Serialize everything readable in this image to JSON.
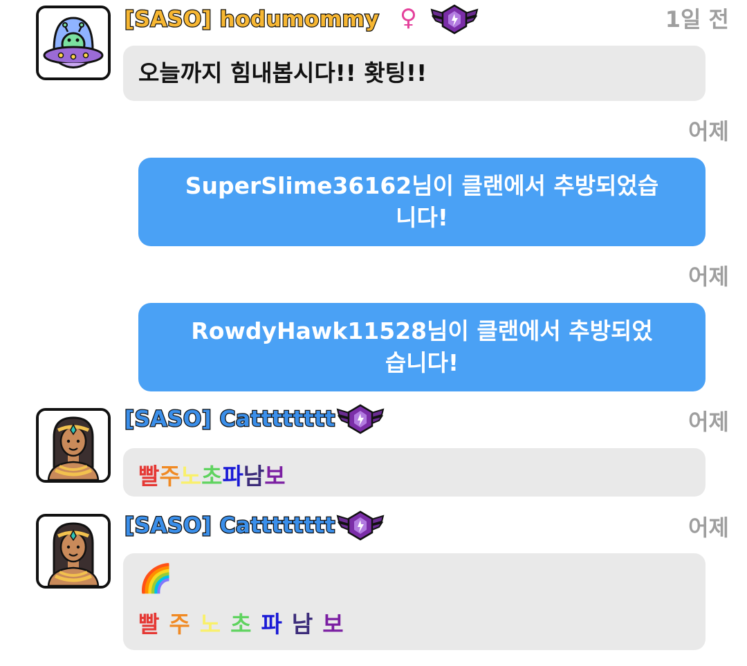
{
  "messages": [
    {
      "username": "[SASO] hodumommy",
      "gender_icon": "♀",
      "badge": "clan-rank-badge-icon",
      "time": "1일 전",
      "text": "오늘까지 힘내봅시다!! 홧팅!!"
    },
    {
      "time": "어제",
      "system_line1": "SuperSlime36162님이 클랜에서 추방되었습",
      "system_line2": "니다!"
    },
    {
      "time": "어제",
      "system_line1": "RowdyHawk11528님이 클랜에서 추방되었",
      "system_line2": "습니다!"
    },
    {
      "username": "[SASO] Catttttttt",
      "badge": "clan-rank-badge-icon",
      "time": "어제",
      "rainbow": [
        "빨",
        "주",
        "노",
        "초",
        "파",
        "남",
        "보"
      ]
    },
    {
      "username": "[SASO] Catttttttt",
      "badge": "clan-rank-badge-icon",
      "time": "어제",
      "emoji": "🌈",
      "rainbow": [
        "빨",
        "주",
        "노",
        "초",
        "파",
        "남",
        "보"
      ]
    }
  ],
  "colors": {
    "rainbow": [
      "#e53935",
      "#f08a24",
      "#f9f06b",
      "#5fd35f",
      "#1a1ad6",
      "#3c2c7a",
      "#7b1fa2"
    ],
    "system_bubble": "#4aa1f5",
    "chat_bubble": "#e9e9e9",
    "timestamp": "#9e9e9e",
    "username_gold": "#f7b733",
    "username_blue": "#3b8fea"
  }
}
